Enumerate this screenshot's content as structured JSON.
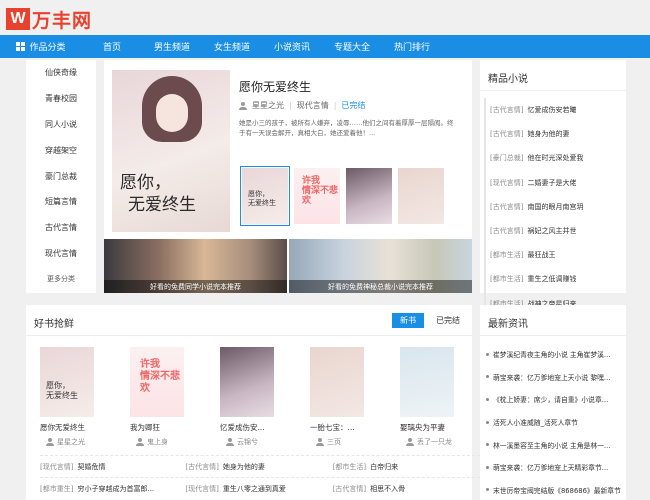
{
  "logo": {
    "mark": "W",
    "text": "万丰网"
  },
  "nav": {
    "category_label": "作品分类",
    "items": [
      "首页",
      "男生频道",
      "女生频道",
      "小说资讯",
      "专题大全",
      "热门排行"
    ]
  },
  "categories": [
    "仙侠奇缘",
    "青春校园",
    "同人小说",
    "穿越架空",
    "豪门总裁",
    "短篇言情",
    "古代言情",
    "现代言情",
    "更多分类"
  ],
  "featured": {
    "cover_line1": "愿你，",
    "cover_line2": "无爱终生",
    "title": "愿你无爱终生",
    "author": "星星之光",
    "genre": "现代言情",
    "status": "已完结",
    "description": "她是小三的孩子，被所有人嫌弃，凌辱……他们之间有着厚厚一层隔阂。终于有一天误会解开，真相大白，她还爱着他！...",
    "thumbs": [
      {
        "text1": "愿你，",
        "text2": "无爱终生"
      },
      {
        "text1": "许我",
        "text2": "情深不悲欢"
      },
      {
        "text1": "",
        "text2": ""
      },
      {
        "text1": "",
        "text2": ""
      }
    ],
    "banners": [
      "好看的免费同学小说完本推荐",
      "好看的免费神秘总裁小说完本推荐"
    ]
  },
  "ranking": {
    "title": "精品小说",
    "items": [
      {
        "tag": "[古代言情]",
        "title": "忆爱成伤安若曦"
      },
      {
        "tag": "[古代言情]",
        "title": "她身为他的妻"
      },
      {
        "tag": "[豪门总裁]",
        "title": "他在时光深处爱我"
      },
      {
        "tag": "[现代言情]",
        "title": "二婚妻子是大佬"
      },
      {
        "tag": "[古代言情]",
        "title": "南国的眼月南宫玥"
      },
      {
        "tag": "[古代言情]",
        "title": "祸妃之风主并世"
      },
      {
        "tag": "[都市生活]",
        "title": "最狂战王"
      },
      {
        "tag": "[都市生活]",
        "title": "重生之低调赚钱"
      },
      {
        "tag": "[都市生活]",
        "title": "战神之帝星归来"
      }
    ]
  },
  "good_books": {
    "title": "好书抢鲜",
    "tabs": [
      "新书",
      "已完结"
    ],
    "books": [
      {
        "name": "愿你无爱终生",
        "author": "星星之光",
        "cover1": "愿你，",
        "cover2": "无爱终生"
      },
      {
        "name": "我为卿狂",
        "author": "鬼上身",
        "cover1": "许我",
        "cover2": "情深不悲欢"
      },
      {
        "name": "忆爱成伤安...",
        "author": "云锦兮",
        "cover1": "",
        "cover2": ""
      },
      {
        "name": "一胎七宝：...",
        "author": "三页",
        "cover1": "",
        "cover2": ""
      },
      {
        "name": "娶璃央为平妻",
        "author": "丢了一只龙",
        "cover1": "",
        "cover2": ""
      }
    ],
    "rows": [
      [
        {
          "tag": "[现代言情]",
          "title": "契婚危情"
        },
        {
          "tag": "[古代言情]",
          "title": "她身为他的妻"
        },
        {
          "tag": "[都市生活]",
          "title": "白帝归来"
        }
      ],
      [
        {
          "tag": "[都市重生]",
          "title": "穷小子穿越成为首富郎..."
        },
        {
          "tag": "[现代言情]",
          "title": "重生八零之通到真爱"
        },
        {
          "tag": "[古代言情]",
          "title": "相思不入骨"
        }
      ]
    ]
  },
  "news": {
    "title": "最新资讯",
    "items": [
      "崔梦溪纪青夜主角的小说 主角崔梦溪...",
      "萌宝来袭：亿万爹地宠上天小说 黎嘿...",
      "《枕上娇妻：席少，请自重》小说章...",
      "活死人小准威随_活死人章节",
      "林一溪墨容至主角的小说 主角是林一...",
      "萌宝来袭：亿万爹地宠上天精彩章节...",
      "末世厉帝宝阀完结版《868686》最新章节"
    ]
  }
}
